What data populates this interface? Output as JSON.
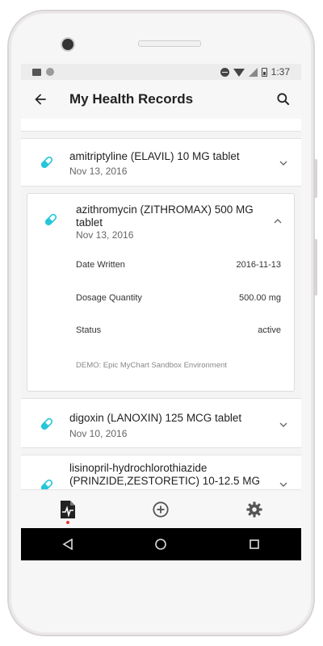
{
  "status_bar": {
    "time": "1:37"
  },
  "app_bar": {
    "title": "My Health Records"
  },
  "records": [
    {
      "name": "amitriptyline (ELAVIL) 10 MG tablet",
      "date": "Nov 13, 2016",
      "expanded": false
    },
    {
      "name": "azithromycin (ZITHROMAX) 500 MG tablet",
      "date": "Nov 13, 2016",
      "expanded": true,
      "details": [
        {
          "label": "Date Written",
          "value": "2016-11-13"
        },
        {
          "label": "Dosage Quantity",
          "value": "500.00 mg"
        },
        {
          "label": "Status",
          "value": "active"
        }
      ],
      "source": "DEMO: Epic MyChart Sandbox Environment"
    },
    {
      "name": "digoxin (LANOXIN) 125 MCG tablet",
      "date": "Nov 10, 2016",
      "expanded": false
    },
    {
      "name": "lisinopril-hydrochlorothiazide (PRINZIDE,ZESTORETIC) 10-12.5 MG",
      "date": "",
      "expanded": false
    }
  ],
  "colors": {
    "accent": "#26c6da",
    "badge": "#e53935"
  },
  "icons": {
    "record_item": "pill-icon",
    "bottom_nav": [
      "health-record-icon",
      "add-circle-icon",
      "settings-icon"
    ],
    "system_nav": [
      "back-triangle-icon",
      "home-circle-icon",
      "recents-square-icon"
    ]
  }
}
